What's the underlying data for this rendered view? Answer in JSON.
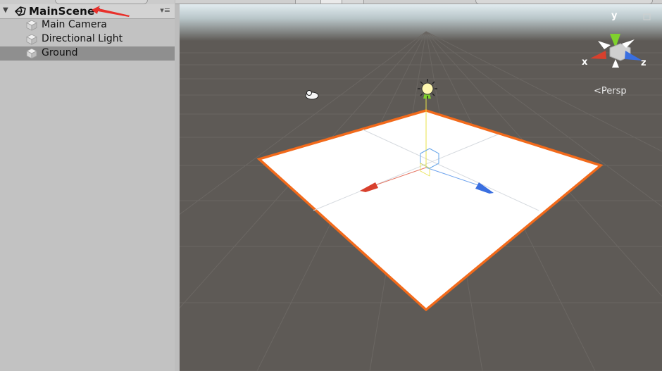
{
  "hierarchy": {
    "scene_name": "MainScene*",
    "items": [
      {
        "label": "Main Camera",
        "selected": false
      },
      {
        "label": "Directional Light",
        "selected": false
      },
      {
        "label": "Ground",
        "selected": true
      }
    ]
  },
  "scene_view": {
    "projection_label": "Persp",
    "gizmo_axes": {
      "x": "x",
      "y": "y",
      "z": "z"
    }
  },
  "colors": {
    "panel_bg": "#c2c2c2",
    "selection": "#8f8f8f",
    "scene_floor": "#5e5a56",
    "sky_top": "#eef7fb",
    "plane_outline": "#f26a1b",
    "axis_x": "#d8402d",
    "axis_y": "#7fd12c",
    "axis_z": "#3a6fe0",
    "annotation_arrow": "#e8302b"
  }
}
